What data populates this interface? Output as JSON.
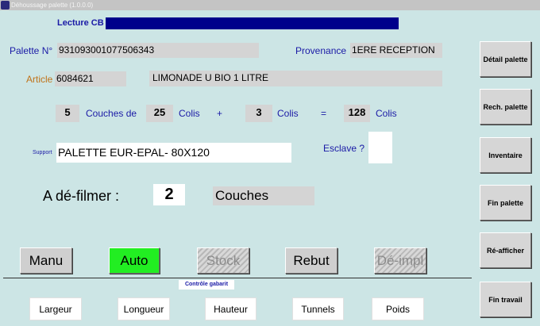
{
  "window": {
    "title": "Déhoussage palette (1.0.0.0)"
  },
  "lecture_cb": {
    "label": "Lecture CB",
    "value": ""
  },
  "palette": {
    "label": "Palette N°",
    "value": "931093001077506343"
  },
  "provenance": {
    "label": "Provenance",
    "value": "1ERE RECEPTION"
  },
  "article": {
    "label": "Article",
    "code": "6084621",
    "description": "LIMONADE U BIO 1 LITRE"
  },
  "calc": {
    "couches": "5",
    "couches_label": "Couches de",
    "colis_par_couche": "25",
    "colis_label": "Colis",
    "plus": "+",
    "colis_extra": "3",
    "colis_label2": "Colis",
    "equals": "=",
    "total": "128",
    "colis_label3": "Colis"
  },
  "support": {
    "label": "Support",
    "value": "PALETTE EUR-EPAL- 80X120"
  },
  "esclave": {
    "label": "Esclave ?",
    "value": ""
  },
  "defilmer": {
    "label": "A dé-filmer :",
    "value": "2",
    "unit": "Couches"
  },
  "side_buttons": {
    "detail": "Détail palette",
    "rech": "Rech. palette",
    "inventaire": "Inventaire",
    "fin_palette": "Fin palette",
    "reafficher": "Ré-afficher",
    "fin_travail": "Fin travail"
  },
  "mode_buttons": {
    "manu": "Manu",
    "auto": "Auto",
    "stock": "Stock",
    "rebut": "Rebut",
    "deimpl": "Dé-impl"
  },
  "gabarit": {
    "title": "Contrôle gabarit",
    "largeur": "Largeur",
    "longueur": "Longueur",
    "hauteur": "Hauteur",
    "tunnels": "Tunnels",
    "poids": "Poids"
  },
  "colors": {
    "background": "#cce5e5",
    "lecture_bar": "#00008b",
    "active_mode": "#22ee22",
    "label_blue": "#1a1aa6",
    "label_orange": "#c0731a"
  }
}
